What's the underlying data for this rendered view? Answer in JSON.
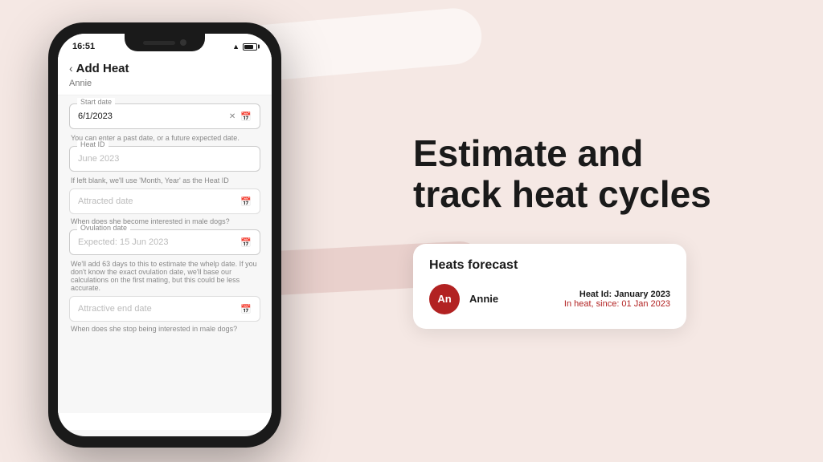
{
  "background": {
    "color": "#f5e8e4"
  },
  "phone": {
    "status_bar": {
      "time": "16:51",
      "wifi_symbol": "▲",
      "battery_label": "battery"
    },
    "header": {
      "back_label": "‹",
      "title": "Add Heat",
      "subtitle": "Annie"
    },
    "form": {
      "start_date_label": "Start date",
      "start_date_value": "6/1/2023",
      "start_date_hint": "You can enter a past date, or a future expected date.",
      "heat_id_label": "Heat ID",
      "heat_id_placeholder": "June 2023",
      "heat_id_hint": "If left blank, we'll use 'Month, Year' as the Heat ID",
      "attracted_date_label": "Attracted date",
      "attracted_date_placeholder": "Attracted date",
      "attracted_date_hint": "When does she become interested in male dogs?",
      "ovulation_label": "Ovulation date",
      "ovulation_placeholder": "Expected: 15 Jun 2023",
      "ovulation_hint": "We'll add 63 days to this to estimate the whelp date. If you don't know the exact ovulation date, we'll base our calculations on the first mating, but this could be less accurate.",
      "attractive_end_label": "Attractive end date",
      "attractive_end_placeholder": "Attractive end date",
      "attractive_end_hint": "When does she stop being interested in male dogs?"
    }
  },
  "right_panel": {
    "headline_line1": "Estimate and",
    "headline_line2": "track heat cycles"
  },
  "forecast_card": {
    "title": "Heats forecast",
    "dog_name": "Annie",
    "avatar_initials": "An",
    "heat_id_label": "Heat Id: January 2023",
    "heat_since": "In heat, since: 01 Jan 2023"
  }
}
